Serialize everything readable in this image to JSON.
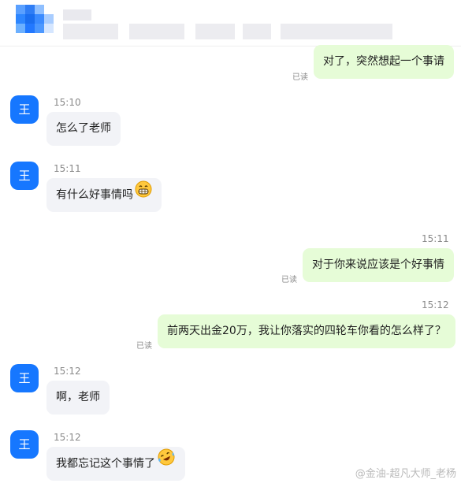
{
  "contact": {
    "avatar_letter": "王"
  },
  "messages": [
    {
      "dir": "out",
      "text": "对了，突然想起一个事请",
      "status": "已读"
    },
    {
      "dir": "in",
      "time": "15:10",
      "text": "怎么了老师"
    },
    {
      "dir": "in",
      "time": "15:11",
      "text": "有什么好事情吗",
      "emoji": "grinning-face-icon"
    },
    {
      "dir": "out",
      "time": "15:11",
      "text": "对于你来说应该是个好事情",
      "status": "已读"
    },
    {
      "dir": "out",
      "time": "15:12",
      "text": "前两天出金20万，我让你落实的四轮车你看的怎么样了？",
      "status": "已读"
    },
    {
      "dir": "in",
      "time": "15:12",
      "text": "啊，老师"
    },
    {
      "dir": "in",
      "time": "15:12",
      "text": "我都忘记这个事情了",
      "emoji": "rofl-face-icon"
    }
  ],
  "watermark": "@金油-超凡大师_老杨",
  "colors": {
    "accent": "#1677ff",
    "out_bubble": "#e6fcd7",
    "in_bubble": "#f2f3f7"
  }
}
